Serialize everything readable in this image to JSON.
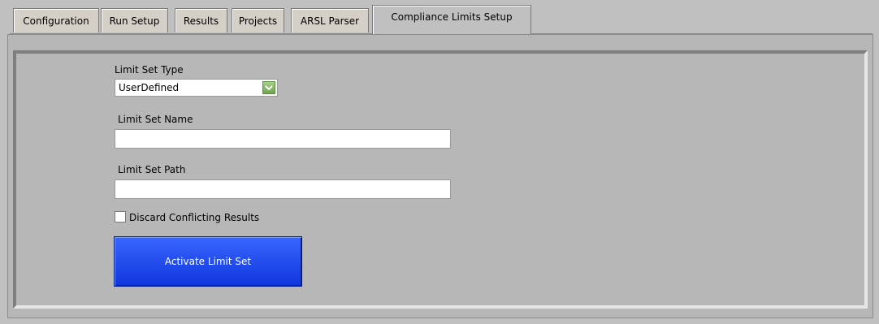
{
  "tabs": [
    {
      "label": "Configuration"
    },
    {
      "label": "Run Setup"
    },
    {
      "label": "Results"
    },
    {
      "label": "Projects"
    },
    {
      "label": "ARSL Parser"
    },
    {
      "label": "Compliance Limits Setup"
    }
  ],
  "active_tab": "Compliance Limits Setup",
  "form": {
    "limit_set_type_label": "Limit Set Type",
    "limit_set_type_value": "UserDefined",
    "limit_set_name_label": "Limit Set Name",
    "limit_set_name_value": "",
    "limit_set_path_label": "Limit Set Path",
    "limit_set_path_value": "",
    "discard_label": "Discard Conflicting Results",
    "discard_checked": false,
    "activate_button_label": "Activate Limit Set"
  },
  "colors": {
    "background": "#c0c0c0",
    "panel": "#b7b7b7",
    "button": "#1f48f0",
    "dropdown_arrow": "#8cbe6a"
  },
  "icons": {
    "dropdown_arrow": "chevron-down-icon"
  }
}
